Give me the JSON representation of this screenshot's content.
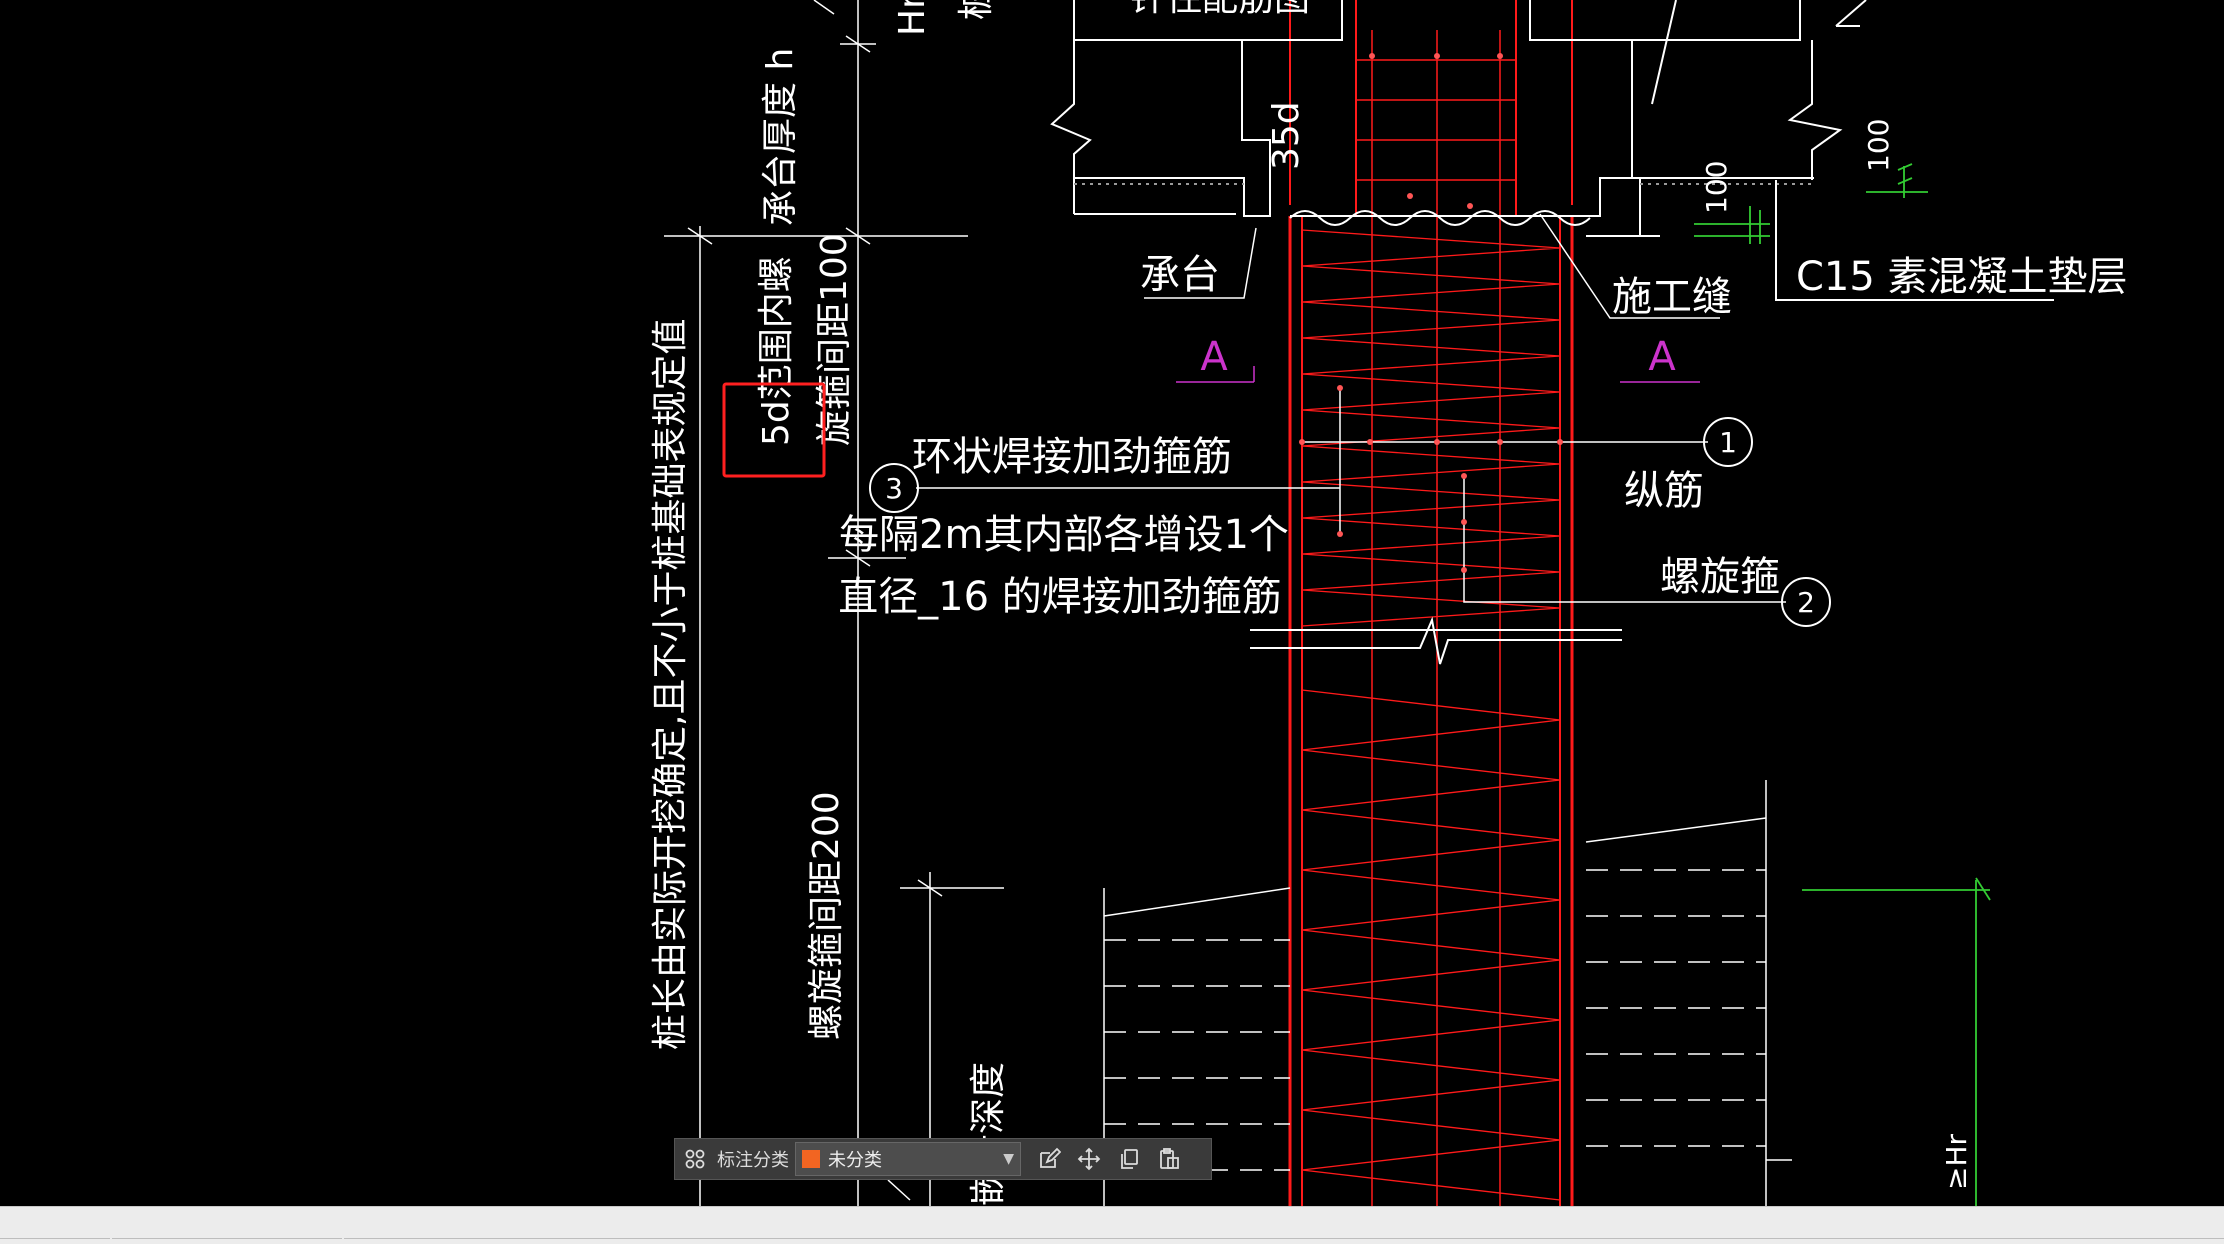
{
  "drawing": {
    "label_cap_thickness": "承台厚度 h",
    "label_hr_top": "Hr",
    "label_pile_top": "桩",
    "label_top_truncated": "钎住配筋图",
    "label_35d": "35d",
    "label_cap": "承台",
    "label_joint": "施工缝",
    "label_c15": "C15 素混凝土垫层",
    "label_100_right": "100",
    "label_100_mid": "100",
    "label_section_a_left": "A",
    "label_section_a_right": "A",
    "label_spiral_dense_1": "5d范围内螺",
    "label_spiral_dense_2": "旋箍间距100",
    "label_ring_stirrup": "环状焊接加劲箍筋",
    "label_every_2m": "每隔2m其内部各增设1个",
    "label_diameter_16": "直径_16 的焊接加劲箍筋",
    "label_longitudinal": "纵筋",
    "label_spiral": "螺旋箍",
    "label_pile_length": "桩长由实际开挖确定,且不小于桩基础表规定值",
    "label_spiral_200": "螺旋箍间距200",
    "label_depth": "嵌岩深度",
    "label_hr_bottom": "≥Hr",
    "callout_1": "1",
    "callout_2": "2",
    "callout_3": "3"
  },
  "toolbar": {
    "category_label": "标注分类",
    "selected_category": "未分类",
    "swatch_color": "#f26522"
  },
  "colors": {
    "rebar": "#ff1a1a",
    "dim_green": "#33cc33",
    "section_magenta": "#cc33cc",
    "selection_box": "#ff2020"
  }
}
